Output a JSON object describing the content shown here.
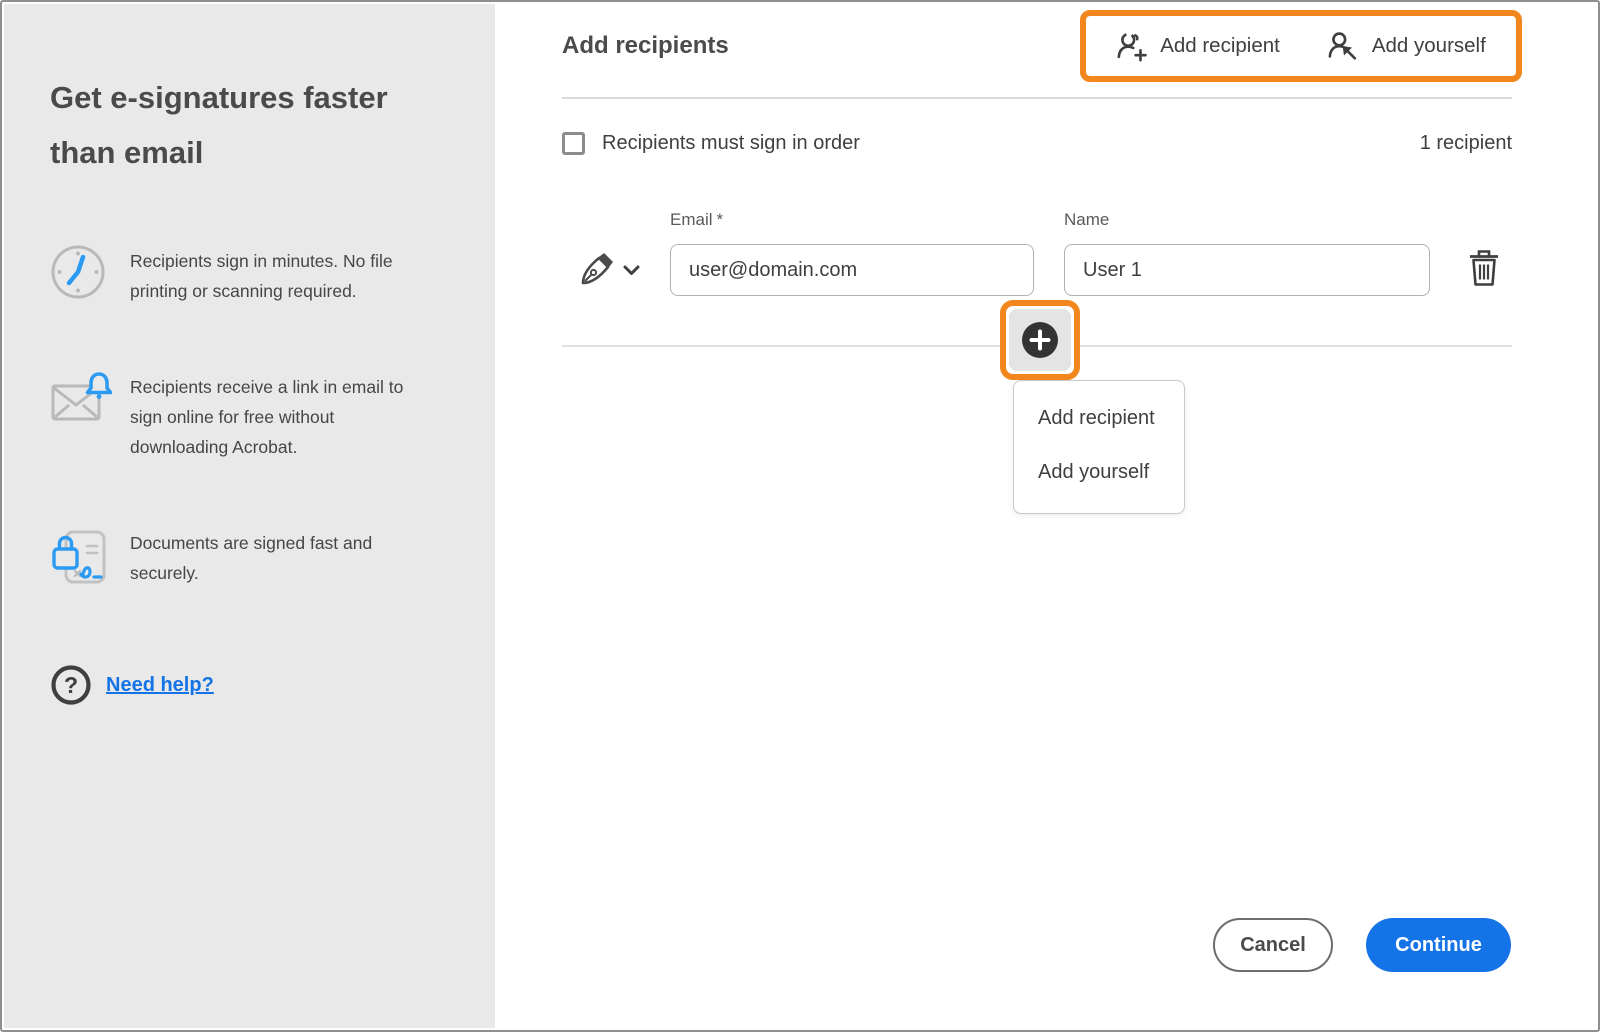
{
  "sidebar": {
    "heading": "Get e-signatures faster than email",
    "bullets": [
      {
        "icon": "clock-icon",
        "text": "Recipients sign in minutes. No file printing or scanning required."
      },
      {
        "icon": "mail-notification-icon",
        "text": "Recipients receive a link in email to sign online for free without downloading Acrobat."
      },
      {
        "icon": "secure-document-icon",
        "text": "Documents are signed fast and securely."
      }
    ],
    "help_link": "Need help?"
  },
  "header": {
    "title": "Add recipients",
    "actions": {
      "add_recipient": "Add recipient",
      "add_yourself": "Add yourself"
    }
  },
  "recipients": {
    "sign_in_order_label": "Recipients must sign in order",
    "sign_in_order_checked": false,
    "count_label": "1 recipient",
    "email_label": "Email",
    "email_required_mark": "*",
    "name_label": "Name",
    "rows": [
      {
        "email": "user@domain.com",
        "name": "User 1"
      }
    ]
  },
  "add_menu": {
    "items": [
      {
        "label": "Add recipient"
      },
      {
        "label": "Add yourself"
      }
    ]
  },
  "footer": {
    "cancel_label": "Cancel",
    "continue_label": "Continue"
  },
  "colors": {
    "highlight_orange": "#F2871D",
    "primary_blue": "#1473E6",
    "icon_blue": "#2B9AF3",
    "sidebar_background": "#E9E9E9"
  }
}
